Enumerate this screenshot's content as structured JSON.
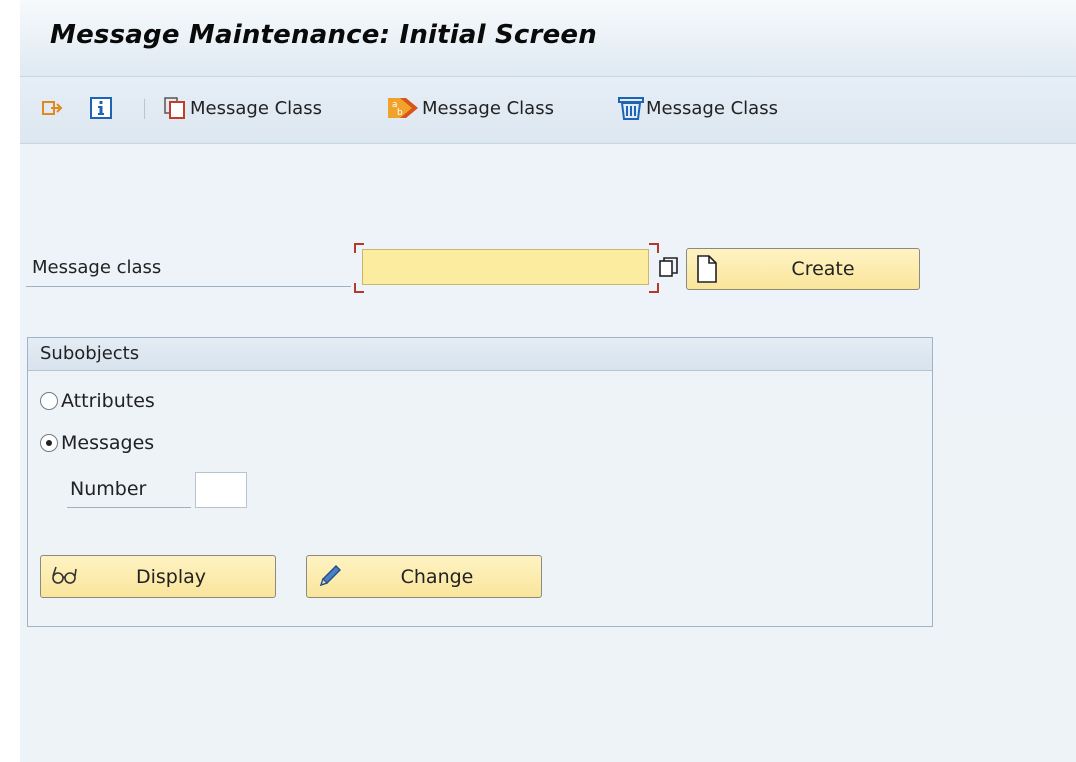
{
  "window": {
    "title": "Message Maintenance: Initial Screen"
  },
  "toolbar": {
    "items": [
      {
        "icon": "other-object-icon",
        "label": ""
      },
      {
        "icon": "info-icon",
        "label": ""
      },
      {
        "icon": "copy-icon",
        "label": "Message Class"
      },
      {
        "icon": "rename-icon",
        "label": "Message Class"
      },
      {
        "icon": "delete-icon",
        "label": "Message Class"
      }
    ]
  },
  "form": {
    "message_class_label": "Message class",
    "message_class_value": "",
    "create_label": "Create"
  },
  "subobjects": {
    "title": "Subobjects",
    "attributes_label": "Attributes",
    "messages_label": "Messages",
    "selected": "Messages",
    "number_label": "Number",
    "number_value": ""
  },
  "actions": {
    "display_label": "Display",
    "change_label": "Change"
  },
  "colors": {
    "title_bg": "#e3ecf5",
    "input_required_bg": "#fbeca0",
    "button_bg": "#fbe9a8",
    "required_bracket": "#b33a2a"
  }
}
